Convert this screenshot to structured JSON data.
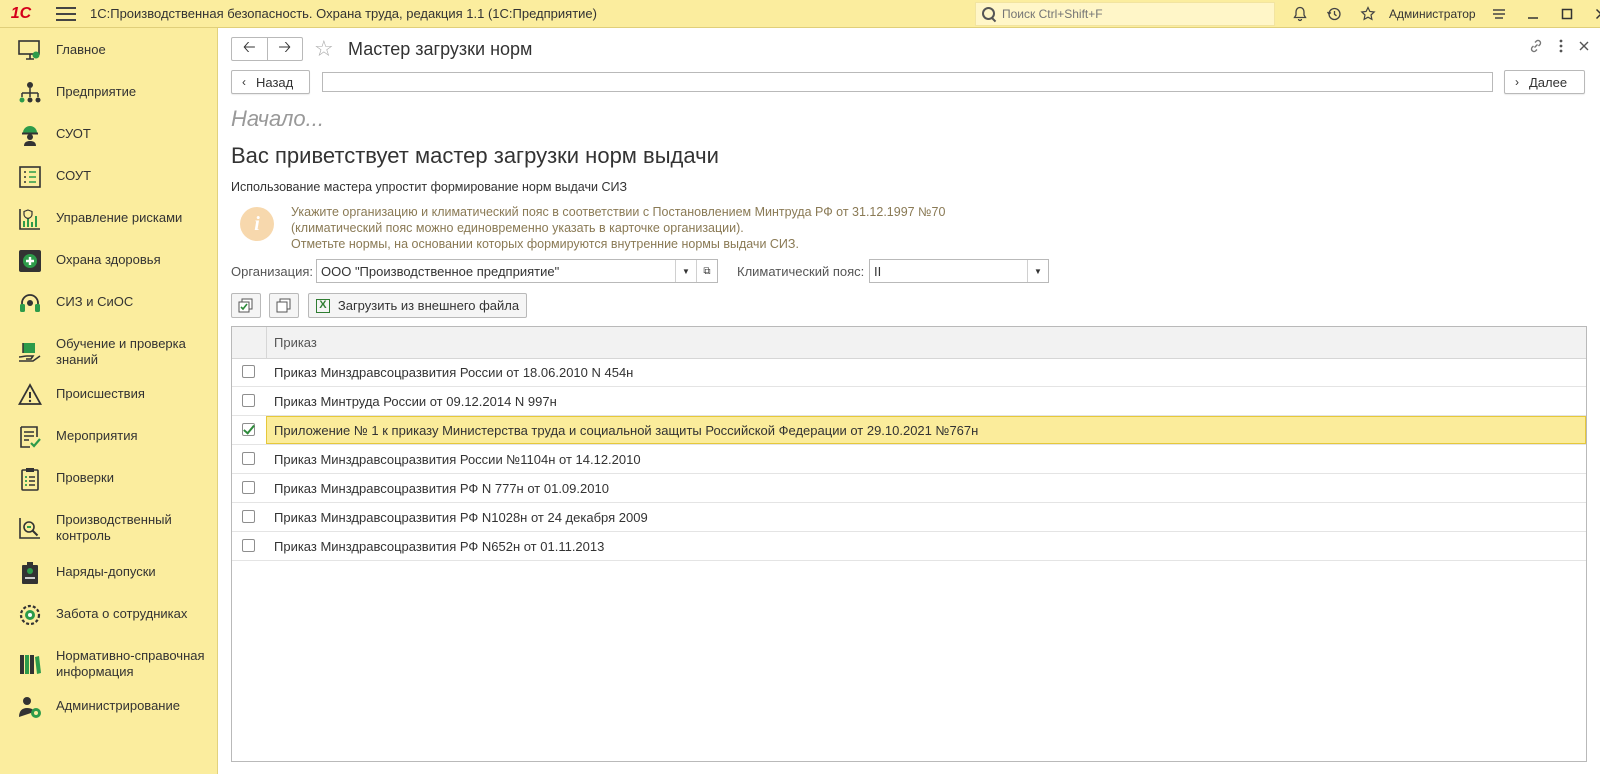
{
  "app": {
    "logo": "1С",
    "title": "1С:Производственная безопасность. Охрана труда, редакция 1.1  (1С:Предприятие)",
    "search_placeholder": "Поиск Ctrl+Shift+F",
    "user": "Администратор"
  },
  "sidebar": {
    "items": [
      {
        "label": "Главное",
        "icon": "monitor-icon"
      },
      {
        "label": "Предприятие",
        "icon": "org-structure-icon"
      },
      {
        "label": "СУОТ",
        "icon": "worker-helmet-icon"
      },
      {
        "label": "СОУТ",
        "icon": "checklist-icon"
      },
      {
        "label": "Управление рисками",
        "icon": "risk-chart-icon"
      },
      {
        "label": "Охрана здоровья",
        "icon": "medical-cross-icon"
      },
      {
        "label": "СИЗ и СиОС",
        "icon": "headset-icon"
      },
      {
        "label": "Обучение и проверка знаний",
        "icon": "book-hand-icon"
      },
      {
        "label": "Происшествия",
        "icon": "warning-icon"
      },
      {
        "label": "Мероприятия",
        "icon": "task-list-icon"
      },
      {
        "label": "Проверки",
        "icon": "clipboard-icon"
      },
      {
        "label": "Производственный контроль",
        "icon": "production-control-icon"
      },
      {
        "label": "Наряды-допуски",
        "icon": "permit-icon"
      },
      {
        "label": "Забота о сотрудниках",
        "icon": "care-gear-icon"
      },
      {
        "label": "Нормативно-справочная информация",
        "icon": "books-icon"
      },
      {
        "label": "Администрирование",
        "icon": "admin-gear-icon"
      }
    ]
  },
  "form": {
    "title": "Мастер загрузки норм",
    "back_label": "Назад",
    "next_label": "Далее",
    "step_title": "Начало...",
    "welcome": "Вас приветствует мастер загрузки норм выдачи",
    "subtitle": "Использование мастера упростит формирование норм выдачи СИЗ",
    "info_lines": [
      "Укажите организацию и климатический пояс в соответствии с Постановлением Минтруда РФ от 31.12.1997 №70",
      "(климатический пояс можно единовременно указать в карточке организации).",
      "Отметьте нормы, на основании которых формируются внутренние нормы выдачи СИЗ."
    ],
    "org_label": "Организация:",
    "org_value": "ООО \"Производственное предприятие\"",
    "climate_label": "Климатический пояс:",
    "climate_value": "II",
    "load_button": "Загрузить из внешнего файла"
  },
  "grid": {
    "header": "Приказ",
    "rows": [
      {
        "text": "Приказ Минздравсоцразвития России от 18.06.2010 N 454н",
        "checked": false,
        "selected": false
      },
      {
        "text": "Приказ Минтруда России от 09.12.2014 N 997н",
        "checked": false,
        "selected": false
      },
      {
        "text": "Приложение № 1 к приказу Министерства труда и социальной защиты Российской Федерации от 29.10.2021 №767н",
        "checked": true,
        "selected": true
      },
      {
        "text": "Приказ Минздравсоцразвития России №1104н от 14.12.2010",
        "checked": false,
        "selected": false
      },
      {
        "text": "Приказ Минздравсоцразвития РФ N 777н от 01.09.2010",
        "checked": false,
        "selected": false
      },
      {
        "text": "Приказ Минздравсоцразвития РФ N1028н от 24 декабря 2009",
        "checked": false,
        "selected": false
      },
      {
        "text": "Приказ Минздравсоцразвития РФ N652н от 01.11.2013",
        "checked": false,
        "selected": false
      }
    ]
  },
  "colors": {
    "panel": "#fbed9e",
    "selected_row": "#fbec9b",
    "info_text": "#8a7a55",
    "check": "#2d8a3a"
  }
}
